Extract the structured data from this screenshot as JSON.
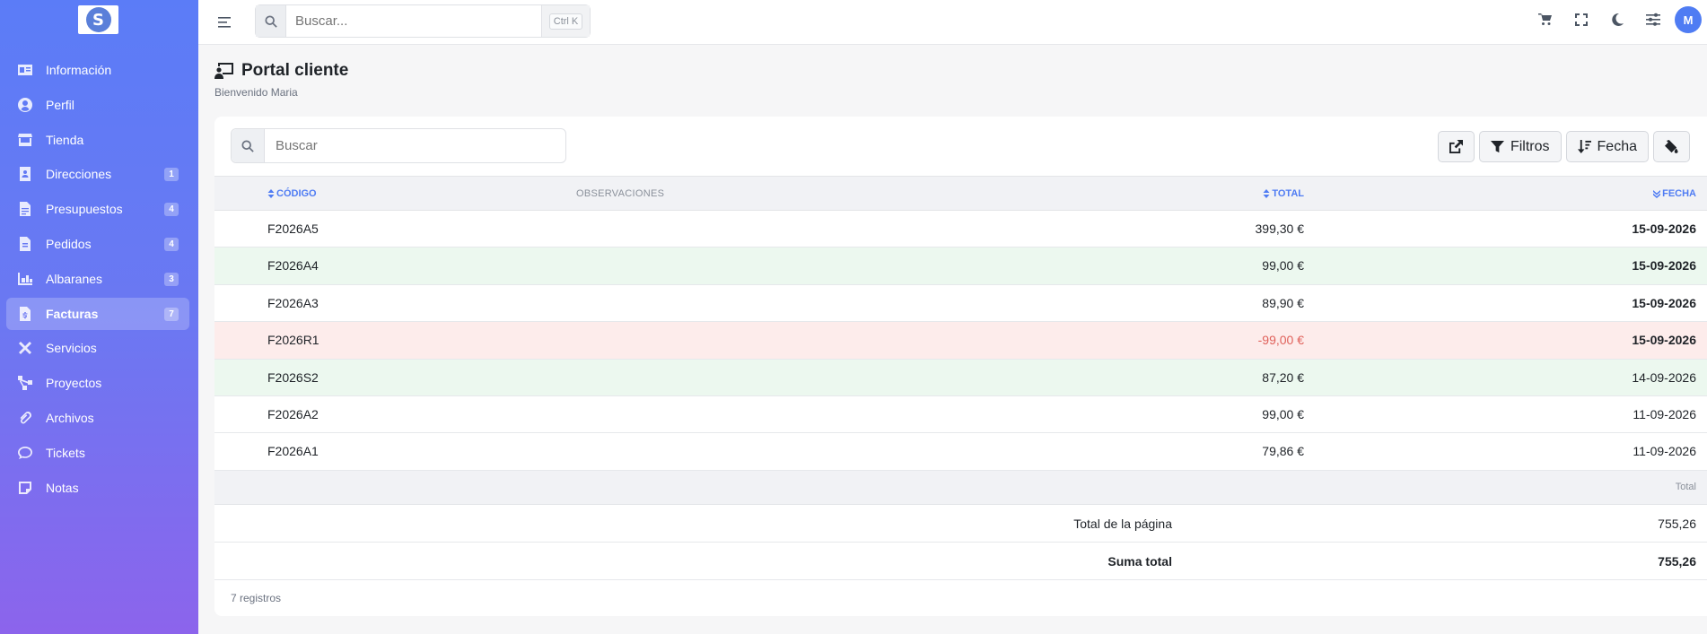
{
  "sidebar": {
    "logo_letter": "S",
    "items": [
      {
        "label": "Información",
        "icon": "id-card-icon",
        "badge": ""
      },
      {
        "label": "Perfil",
        "icon": "user-circle-icon",
        "badge": ""
      },
      {
        "label": "Tienda",
        "icon": "store-icon",
        "badge": ""
      },
      {
        "label": "Direcciones",
        "icon": "address-book-icon",
        "badge": "1"
      },
      {
        "label": "Presupuestos",
        "icon": "file-icon",
        "badge": "4"
      },
      {
        "label": "Pedidos",
        "icon": "file-list-icon",
        "badge": "4"
      },
      {
        "label": "Albaranes",
        "icon": "boxes-icon",
        "badge": "3"
      },
      {
        "label": "Facturas",
        "icon": "invoice-icon",
        "badge": "7",
        "active": true
      },
      {
        "label": "Servicios",
        "icon": "tools-icon",
        "badge": ""
      },
      {
        "label": "Proyectos",
        "icon": "project-diagram-icon",
        "badge": ""
      },
      {
        "label": "Archivos",
        "icon": "paperclip-icon",
        "badge": ""
      },
      {
        "label": "Tickets",
        "icon": "comment-icon",
        "badge": ""
      },
      {
        "label": "Notas",
        "icon": "sticky-note-icon",
        "badge": ""
      }
    ]
  },
  "topbar": {
    "search_placeholder": "Buscar...",
    "shortcut": "Ctrl K",
    "avatar": "M"
  },
  "header": {
    "title": "Portal cliente",
    "subtitle": "Bienvenido Maria"
  },
  "toolbar": {
    "search_placeholder": "Buscar",
    "filters_label": "Filtros",
    "sort_label": "Fecha"
  },
  "table": {
    "columns": {
      "code": "CÓDIGO",
      "observations": "OBSERVACIONES",
      "total": "TOTAL",
      "date": "FECHA"
    },
    "rows": [
      {
        "code": "F2026A5",
        "total": "399,30 €",
        "date": "15-09-2026",
        "state": "normal",
        "bold_date": true
      },
      {
        "code": "F2026A4",
        "total": "99,00 €",
        "date": "15-09-2026",
        "state": "green",
        "bold_date": true
      },
      {
        "code": "F2026A3",
        "total": "89,90 €",
        "date": "15-09-2026",
        "state": "normal",
        "bold_date": true
      },
      {
        "code": "F2026R1",
        "total": "-99,00 €",
        "date": "15-09-2026",
        "state": "red",
        "bold_date": true
      },
      {
        "code": "F2026S2",
        "total": "87,20 €",
        "date": "14-09-2026",
        "state": "green",
        "bold_date": false
      },
      {
        "code": "F2026A2",
        "total": "99,00 €",
        "date": "11-09-2026",
        "state": "normal",
        "bold_date": false
      },
      {
        "code": "F2026A1",
        "total": "79,86 €",
        "date": "11-09-2026",
        "state": "normal",
        "bold_date": false
      }
    ]
  },
  "footer": {
    "total_header": "Total",
    "page_total_label": "Total de la página",
    "page_total_value": "755,26",
    "sum_total_label": "Suma total",
    "sum_total_value": "755,26",
    "records": "7 registros"
  },
  "colors": {
    "accent": "#4f7cf3",
    "negative": "#e0625b",
    "row_green": "#ecf8ef",
    "row_red": "#fdeceb"
  }
}
